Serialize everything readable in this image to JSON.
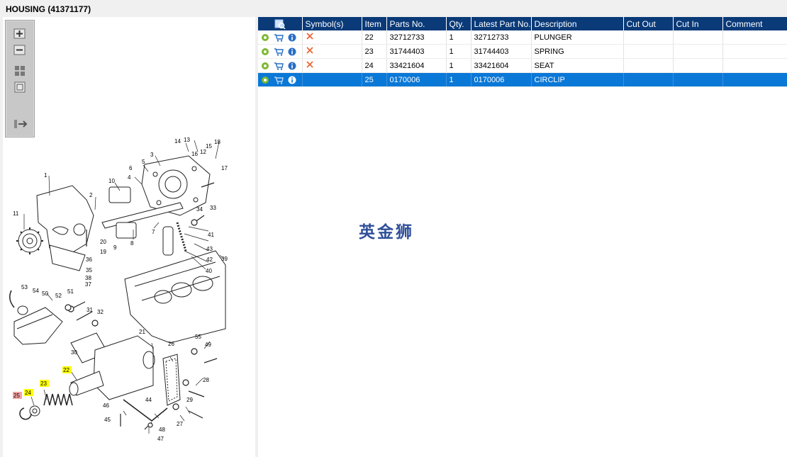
{
  "window": {
    "title": "HOUSING (41371177)"
  },
  "toolbox": {
    "buttons": [
      {
        "name": "zoom-in-icon"
      },
      {
        "name": "zoom-out-icon"
      },
      {
        "name": "fit-all-icon"
      },
      {
        "name": "fit-page-icon"
      },
      {
        "name": "export-icon"
      }
    ]
  },
  "table": {
    "headers": [
      "",
      "Symbol(s)",
      "Item",
      "Parts No.",
      "Qty.",
      "Latest Part No.",
      "Description",
      "Cut Out",
      "Cut In",
      "Comment"
    ],
    "rows": [
      {
        "item": "22",
        "part_no": "32712733",
        "qty": "1",
        "latest": "32712733",
        "desc": "PLUNGER",
        "cut_out": "",
        "cut_in": "",
        "comment": "",
        "symbol": "cross",
        "selected": false
      },
      {
        "item": "23",
        "part_no": "31744403",
        "qty": "1",
        "latest": "31744403",
        "desc": "SPRING",
        "cut_out": "",
        "cut_in": "",
        "comment": "",
        "symbol": "cross",
        "selected": false
      },
      {
        "item": "24",
        "part_no": "33421604",
        "qty": "1",
        "latest": "33421604",
        "desc": "SEAT",
        "cut_out": "",
        "cut_in": "",
        "comment": "",
        "symbol": "cross",
        "selected": false
      },
      {
        "item": "25",
        "part_no": "0170006",
        "qty": "1",
        "latest": "0170006",
        "desc": "CIRCLIP",
        "cut_out": "",
        "cut_in": "",
        "comment": "",
        "symbol": "",
        "selected": true
      }
    ]
  },
  "watermark": "英金狮",
  "diagram": {
    "callouts": [
      "1",
      "2",
      "3",
      "4",
      "5",
      "6",
      "7",
      "8",
      "9",
      "10",
      "11",
      "12",
      "13",
      "14",
      "15",
      "16",
      "17",
      "18",
      "19",
      "20",
      "21",
      "22",
      "23",
      "24",
      "25",
      "26",
      "27",
      "28",
      "29",
      "30",
      "31",
      "32",
      "33",
      "34",
      "35",
      "36",
      "37",
      "38",
      "39",
      "40",
      "41",
      "42",
      "43",
      "44",
      "45",
      "46",
      "47",
      "48",
      "49",
      "50",
      "51",
      "52",
      "53",
      "54",
      "55"
    ],
    "highlighted": [
      "22",
      "23",
      "24"
    ],
    "selected": "25"
  },
  "colors": {
    "header_bg": "#0a3a78",
    "selected_row": "#0a78d7",
    "highlight": "#ffff00",
    "selected_callout": "#f4a3a3",
    "cross": "#e8602c"
  }
}
